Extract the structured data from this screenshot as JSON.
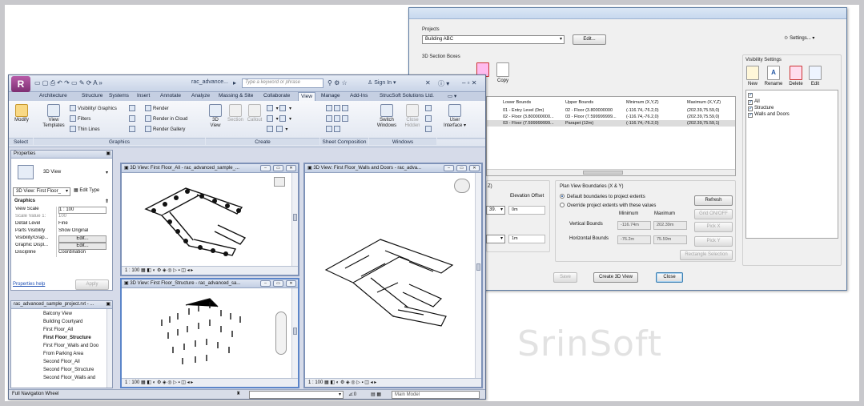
{
  "dialog": {
    "projects_label": "Projects",
    "project_value": "Building ABC",
    "edit_button": "Edit...",
    "settings_button": "Settings...",
    "section_boxes_label": "3D Section Boxes",
    "copy_label": "Copy",
    "partial_char": "e",
    "table_headers": [
      "Lower Bounds",
      "Upper Bounds",
      "Minimum (X,Y,Z)",
      "Maximum (X,Y,Z)"
    ],
    "table_rows": [
      [
        "01 - Entry Level (0m)",
        "02 - Floor (3.800000000",
        "(-116.74,-76.2,0)",
        "(202.39,75.59,0)"
      ],
      [
        "02 - Floor (3.800000000...",
        "03 - Floor (7.599999999...",
        "(-116.74,-76.2,0)",
        "(202.39,75.59,0)"
      ],
      [
        "03 - Floor (7.599999999...",
        "Parapet (12m)",
        "(-116.74,-76.2,0)",
        "(202.39,75.59,1)"
      ]
    ],
    "z_label": "Z)",
    "elevation_offset_label": "Elevation Offset",
    "elevation_combo_partial": "39.",
    "elevation_value_1": "0m",
    "elevation_value_2": "1m",
    "plan_view_label": "Plan View Boundaries  (X & Y)",
    "default_boundaries": "Default boundaries to project extents",
    "override_extents": "Override project extents with these values",
    "minimum_label": "Minimum",
    "maximum_label": "Maximum",
    "vertical_bounds_label": "Vertical Bounds",
    "vertical_min": "-116.74m",
    "vertical_max": "202.39m",
    "horizontal_bounds_label": "Horizontal Bounds",
    "horizontal_min": "-76.2m",
    "horizontal_max": "75.59m",
    "refresh_button": "Refresh",
    "grid_onoff_button": "Grid ON/OFF",
    "pick_x_button": "Pick X",
    "pick_y_button": "Pick Y",
    "rect_selection_button": "Rectangle Selection",
    "save_button": "Save",
    "create_3d_button": "Create 3D View",
    "close_button": "Close",
    "visibility_label": "Visibility Settings",
    "vis_new": "New",
    "vis_rename": "Rename",
    "vis_delete": "Delete",
    "vis_edit": "Edit",
    "vis_items": [
      "All",
      "Structure",
      "Walls and Doors"
    ]
  },
  "revit": {
    "app_title": "rac_advance...",
    "search_placeholder": "Type a keyword or phrase",
    "sign_in": "Sign In",
    "tabs": [
      "Architecture",
      "Structure",
      "Systems",
      "Insert",
      "Annotate",
      "Analyze",
      "Massing & Site",
      "Collaborate",
      "View",
      "Manage",
      "Add-Ins",
      "StrucSoft Solutions Ltd."
    ],
    "active_tab": "View",
    "ribbon": {
      "modify": "Modify",
      "view_templates": "View Templates",
      "visibility_graphics": "Visibility/ Graphics",
      "filters": "Filters",
      "thin_lines": "Thin Lines",
      "render": "Render",
      "render_cloud": "Render in Cloud",
      "render_gallery": "Render Gallery",
      "view_3d": "3D View",
      "section": "Section",
      "callout": "Callout",
      "switch_windows": "Switch Windows",
      "close_hidden": "Close Hidden",
      "user_interface": "User Interface",
      "panels": [
        "Select",
        "Graphics",
        "Create",
        "Sheet Composition",
        "Windows"
      ]
    },
    "properties": {
      "title": "Properties",
      "type": "3D View",
      "selector": "3D View: First Floor_",
      "edit_type": "Edit Type",
      "section": "Graphics",
      "rows": [
        [
          "View Scale",
          "1 : 100"
        ],
        [
          "Scale Value  1:",
          "100"
        ],
        [
          "Detail Level",
          "Fine"
        ],
        [
          "Parts Visibility",
          "Show Original"
        ],
        [
          "Visibility/Grap...",
          "Edit..."
        ],
        [
          "Graphic Displ...",
          "Edit..."
        ],
        [
          "Discipline",
          "Coordination"
        ]
      ],
      "help_link": "Properties help",
      "apply": "Apply"
    },
    "browser": {
      "title": "rac_advanced_sample_project.rvt - ...",
      "items": [
        "Balcony View",
        "Building Courtyard",
        "First Floor_All",
        "First Floor_Structure",
        "First Floor_Walls and Doo",
        "From Parking Area",
        "Second Floor_All",
        "Second Floor_Structure",
        "Second Floor_Walls and"
      ],
      "bold_item": "First Floor_Structure"
    },
    "views": [
      {
        "title": "3D View: First Floor_All - rac_advanced_sample_...",
        "scale": "1 : 100"
      },
      {
        "title": "3D View: First Floor_Structure - rac_advanced_sa...",
        "scale": "1 : 100"
      },
      {
        "title": "3D View: First Floor_Walls and Doors - rac_adva...",
        "scale": "1 : 100"
      }
    ],
    "status_left": "Full Navigation Wheel",
    "status_zero": ":0",
    "status_model": "Main Model"
  },
  "watermark": "SrinSoft",
  "colors": {
    "revit_menu": "#8b3a80",
    "dialog_border": "#5d7ca3",
    "active_tab": "#f4f6fa"
  }
}
